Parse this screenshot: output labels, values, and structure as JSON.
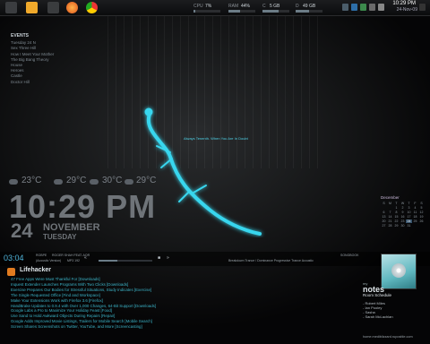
{
  "topbar": {
    "stats": [
      {
        "label": "CPU",
        "value": "7%",
        "fill": 0.07
      },
      {
        "label": "RAM",
        "value": "44%",
        "fill": 0.44
      },
      {
        "label": "C",
        "value": "5 GB",
        "fill": 0.6
      },
      {
        "label": "D",
        "value": "49 GB",
        "fill": 0.5
      }
    ],
    "time": "10:29 PM",
    "date": "24-Nov-09"
  },
  "events": {
    "title": "EVENTS",
    "items": [
      "Tuesday 24 N",
      "Sex Three Hill",
      "How I Meet Your Mother",
      "The Big Bang Theory",
      "House",
      "Heroes",
      "Castle",
      "Doctor Hill"
    ]
  },
  "lizard_text": "Always Tenenth. When You Are In Doubt",
  "weather": [
    {
      "temp": "23°C"
    },
    {
      "temp": "29°C"
    },
    {
      "temp": "30°C"
    },
    {
      "temp": "29°C"
    }
  ],
  "clock": {
    "time": "10:29 PM",
    "day": "24",
    "month": "NOVEMBER",
    "weekday": "TUESDAY"
  },
  "calendar": {
    "title": "December",
    "headers": [
      "S",
      "M",
      "T",
      "W",
      "T",
      "F",
      "S"
    ],
    "days": [
      "",
      "",
      "1",
      "2",
      "3",
      "4",
      "5",
      "6",
      "7",
      "8",
      "9",
      "10",
      "11",
      "12",
      "13",
      "14",
      "15",
      "16",
      "17",
      "18",
      "19",
      "20",
      "21",
      "22",
      "23",
      "24",
      "25",
      "26",
      "27",
      "28",
      "29",
      "30",
      "31",
      "",
      "",
      ""
    ],
    "highlight": "24"
  },
  "music": {
    "time": "03:04",
    "track": "ROBPE",
    "artist": "ROGER SHAH FEAT. AOR",
    "mix": "(Acoustic Version)",
    "bitrate": "MP3 192",
    "controls": [
      "«",
      "■",
      "»"
    ],
    "progress": 0.35,
    "songbook_label": "SONGBOOK",
    "songbook_sub": "Breakdown Trance / Dominance Progressive Trance Acoustic"
  },
  "rss": {
    "title": "Lifehacker",
    "items": [
      "47 Free Apps Were Must Thankful For [Downloads]",
      "Inquest Extender Launches Programs With Two Clicks [Downloads]",
      "Exercise Prepares Our Bodies for Stressful Situations, Study Indicates [Exercise]",
      "The Single Requested Office [Find and Workspace]",
      "Make Your Extensions Work with Firefox 3.6 [Firefox]",
      "HandBrake Updates to 0.9.4 with Over 1,000 Changes, 64-Bit Support [Downloads]",
      "Google Labs a Pro to Maximize Your Holiday Feast [Food]",
      "Use Sand to Hold Awkward Objects During Repairs [Repair]",
      "Google Adds Improved Movie Listings, Trailers for Mobile Search [Mobile Search]",
      "Screen Shares Screenshots on Twitter, YouTube, and More [Screencasting]"
    ]
  },
  "notes": {
    "my": "my",
    "title": "notes",
    "subtitle": "Room Schedule",
    "items": [
      "- Robert Miles",
      "- Ian Pooley",
      "- Sasha",
      "- Sarah McLachlan"
    ],
    "footer": "home.mediblizzard.ruposttle.com"
  }
}
